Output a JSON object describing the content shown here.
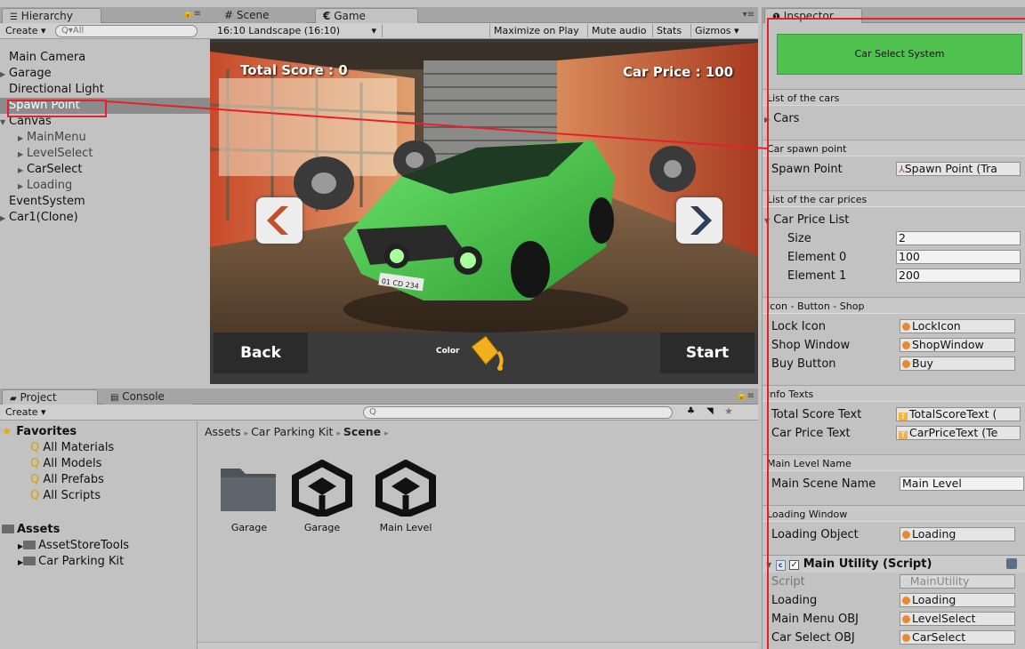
{
  "hierarchy": {
    "tab_label": "Hierarchy",
    "create_label": "Create",
    "search_placeholder": "Q▾All",
    "items": [
      {
        "label": "Main Camera"
      },
      {
        "label": "Garage"
      },
      {
        "label": "Directional Light"
      },
      {
        "label": "Spawn Point"
      },
      {
        "label": "Canvas"
      },
      {
        "label": "MainMenu"
      },
      {
        "label": "LevelSelect"
      },
      {
        "label": "CarSelect"
      },
      {
        "label": "Loading"
      },
      {
        "label": "EventSystem"
      },
      {
        "label": "Car1(Clone)"
      }
    ]
  },
  "game": {
    "tab_scene": "Scene",
    "tab_game": "Game",
    "aspect": "16:10 Landscape (16:10)",
    "toolbar": [
      "Maximize on Play",
      "Mute audio",
      "Stats",
      "Gizmos"
    ],
    "total_score": "Total Score :  0",
    "car_price": "Car Price : 100",
    "back_label": "Back",
    "start_label": "Start",
    "color_label": "Color",
    "plate": "01 CD 234"
  },
  "inspector": {
    "tab_label": "Inspector",
    "system_button": "Car Select System",
    "sections": {
      "cars_header": "List of the cars",
      "cars_label": "Cars",
      "spawn_header": "Car spawn point",
      "spawn_label": "Spawn Point",
      "spawn_value": "Spawn Point (Tra",
      "prices_header": "List of the car prices",
      "price_list_label": "Car Price List",
      "size_label": "Size",
      "size_value": "2",
      "el0_label": "Element 0",
      "el0_value": "100",
      "el1_label": "Element 1",
      "el1_value": "200",
      "ibs_header": "Icon - Button - Shop",
      "lock_label": "Lock Icon",
      "lock_value": "LockIcon",
      "shop_label": "Shop Window",
      "shop_value": "ShopWindow",
      "buy_label": "Buy Button",
      "buy_value": "Buy",
      "info_header": "Info Texts",
      "total_label": "Total Score Text",
      "total_value": "TotalScoreText (",
      "price_label": "Car Price Text",
      "price_value": "CarPriceText (Te",
      "level_header": "Main Level Name",
      "scene_label": "Main Scene Name",
      "scene_value": "Main Level",
      "loading_header": "Loading Window",
      "loading_label": "Loading Object",
      "loading_value": "Loading"
    },
    "utility": {
      "title": "Main Utility (Script)",
      "script_label": "Script",
      "script_value": "MainUtility",
      "loading_label": "Loading",
      "loading_value": "Loading",
      "menu_label": "Main Menu OBJ",
      "menu_value": "LevelSelect",
      "select_label": "Car Select OBJ",
      "select_value": "CarSelect"
    }
  },
  "project": {
    "tab_project": "Project",
    "tab_console": "Console",
    "create_label": "Create",
    "favorites_label": "Favorites",
    "favorites": [
      "All Materials",
      "All Models",
      "All Prefabs",
      "All Scripts"
    ],
    "assets_label": "Assets",
    "asset_folders": [
      "AssetStoreTools",
      "Car Parking Kit"
    ],
    "breadcrumb": [
      "Assets",
      "Car Parking Kit",
      "Scene"
    ],
    "assets": [
      {
        "label": "Garage",
        "kind": "folder"
      },
      {
        "label": "Garage",
        "kind": "unity-scene"
      },
      {
        "label": "Main Level",
        "kind": "unity-scene"
      }
    ]
  },
  "colors": {
    "accent_green": "#4ec14e",
    "car_green": "#47c84a",
    "highlight_red": "#e3202c",
    "selection": "#8b8b8b"
  }
}
